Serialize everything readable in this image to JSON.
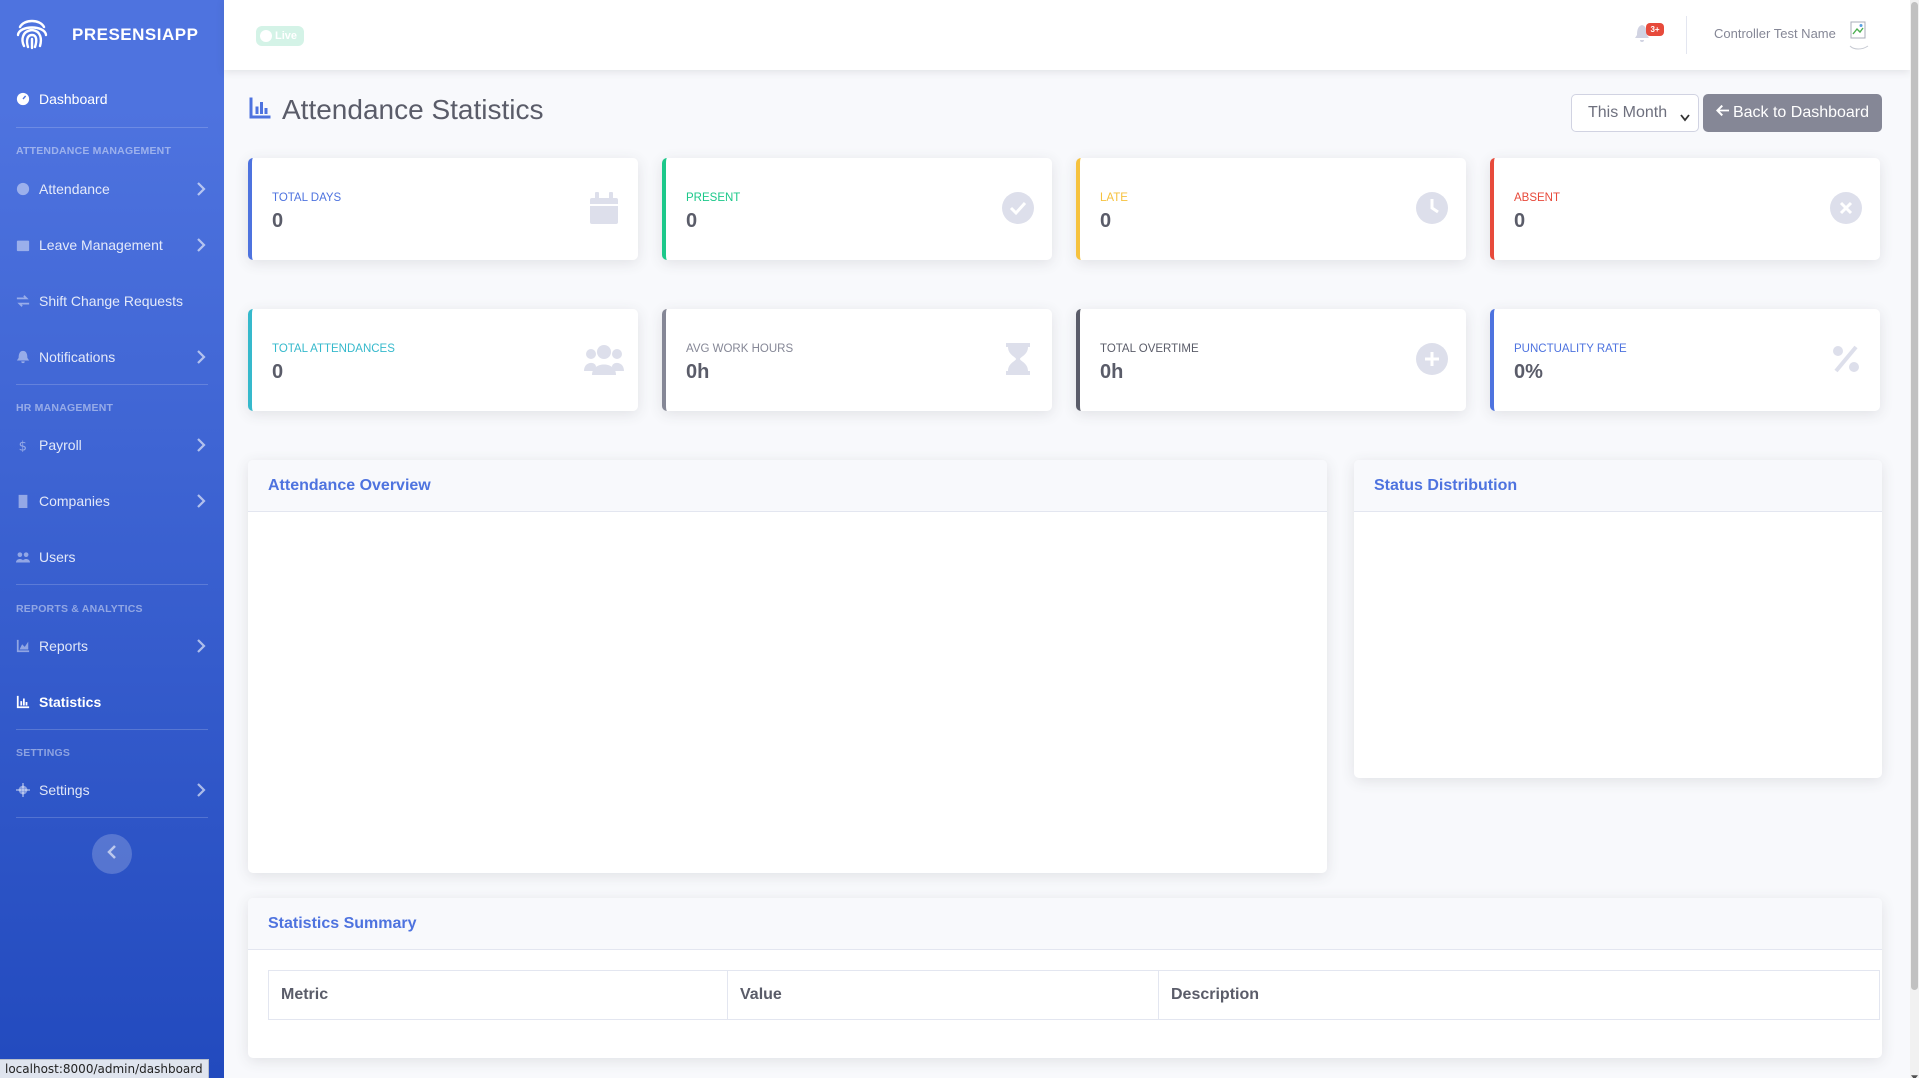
{
  "brand": {
    "name": "PRESENSIAPP"
  },
  "sidebar": {
    "dashboard": "Dashboard",
    "sections": {
      "attendance_management": "ATTENDANCE MANAGEMENT",
      "hr_management": "HR MANAGEMENT",
      "reports_analytics": "REPORTS & ANALYTICS",
      "settings": "SETTINGS"
    },
    "items": {
      "attendance": "Attendance",
      "leave_management": "Leave Management",
      "shift_change_requests": "Shift Change Requests",
      "notifications": "Notifications",
      "payroll": "Payroll",
      "companies": "Companies",
      "users": "Users",
      "reports": "Reports",
      "statistics": "Statistics",
      "settings": "Settings"
    },
    "active": "Statistics"
  },
  "status_url": "localhost:8000/admin/dashboard",
  "topbar": {
    "live_label": "Live",
    "notification_count": "3+",
    "user_name": "Controller Test Name"
  },
  "page": {
    "title": "Attendance Statistics",
    "period_selected": "This Month",
    "back_button": "Back to Dashboard"
  },
  "stats_row1": [
    {
      "label": "TOTAL DAYS",
      "value": "0",
      "color": "#4e73df",
      "icon": "calendar-icon"
    },
    {
      "label": "PRESENT",
      "value": "0",
      "color": "#1cc88a",
      "icon": "check-circle-icon"
    },
    {
      "label": "LATE",
      "value": "0",
      "color": "#f6c23e",
      "icon": "clock-icon"
    },
    {
      "label": "ABSENT",
      "value": "0",
      "color": "#e74a3b",
      "icon": "times-circle-icon"
    }
  ],
  "stats_row2": [
    {
      "label": "TOTAL ATTENDANCES",
      "value": "0",
      "color": "#36b9cc",
      "icon": "users-icon"
    },
    {
      "label": "AVG WORK HOURS",
      "value": "0h",
      "color": "#858796",
      "icon": "hourglass-icon"
    },
    {
      "label": "TOTAL OVERTIME",
      "value": "0h",
      "color": "#5a5c69",
      "icon": "plus-circle-icon"
    },
    {
      "label": "PUNCTUALITY RATE",
      "value": "0%",
      "color": "#4e73df",
      "icon": "percent-icon"
    }
  ],
  "panels": {
    "attendance_overview": "Attendance Overview",
    "status_distribution": "Status Distribution",
    "statistics_summary": "Statistics Summary"
  },
  "summary_table": {
    "columns": [
      "Metric",
      "Value",
      "Description"
    ]
  }
}
